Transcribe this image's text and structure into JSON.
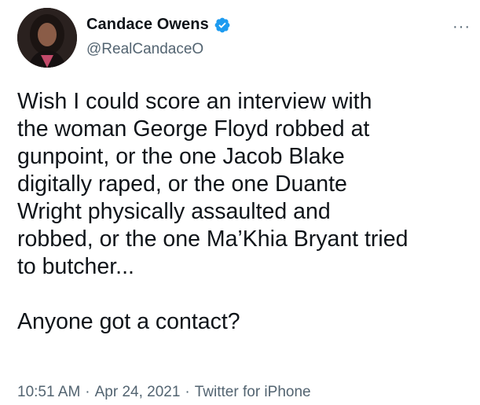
{
  "author": {
    "display_name": "Candace Owens",
    "handle": "@RealCandaceO",
    "verified": true,
    "avatar_icon": "profile-photo",
    "verified_icon": "verified-badge-icon",
    "verified_color": "#1d9bf0"
  },
  "menu": {
    "more_glyph": "···"
  },
  "tweet": {
    "text": "Wish I could score an interview with\nthe woman George Floyd robbed at\ngunpoint, or the one Jacob Blake\ndigitally raped, or the one Duante\nWright physically assaulted and\nrobbed, or the one Ma’Khia Bryant tried\nto butcher...\n\nAnyone got a contact?"
  },
  "meta": {
    "time": "10:51 AM",
    "separator_1": "·",
    "date": "Apr 24, 2021",
    "separator_2": "·",
    "source": "Twitter for iPhone"
  }
}
